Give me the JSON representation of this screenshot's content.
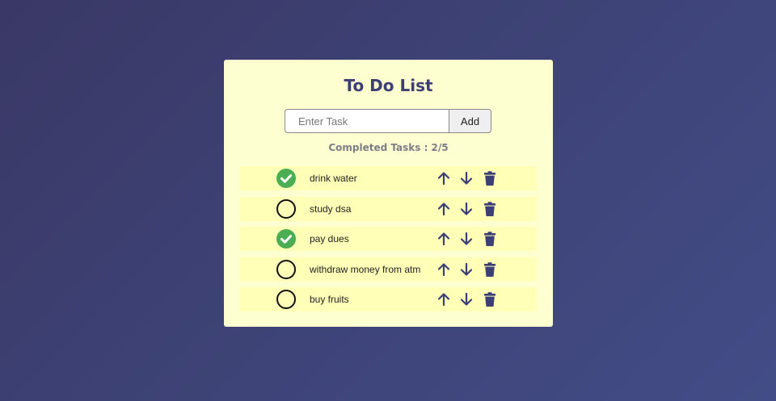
{
  "app": {
    "title": "To Do List"
  },
  "input": {
    "placeholder": "Enter Task",
    "value": "",
    "add_label": "Add"
  },
  "summary": {
    "completed_text": "Completed Tasks : 2/5"
  },
  "tasks": [
    {
      "text": "drink water",
      "done": true
    },
    {
      "text": "study dsa",
      "done": false
    },
    {
      "text": "pay dues",
      "done": true
    },
    {
      "text": "withdraw money from atm",
      "done": false
    },
    {
      "text": "buy fruits",
      "done": false
    }
  ],
  "colors": {
    "accent": "#3b3f74",
    "card_bg": "#fdffd1",
    "row_bg": "#ffffb7",
    "check_done": "#4cae52"
  },
  "icons": {
    "done": "check-circle-icon",
    "todo": "empty-circle-icon",
    "up": "arrow-up-icon",
    "down": "arrow-down-icon",
    "delete": "trash-icon"
  }
}
